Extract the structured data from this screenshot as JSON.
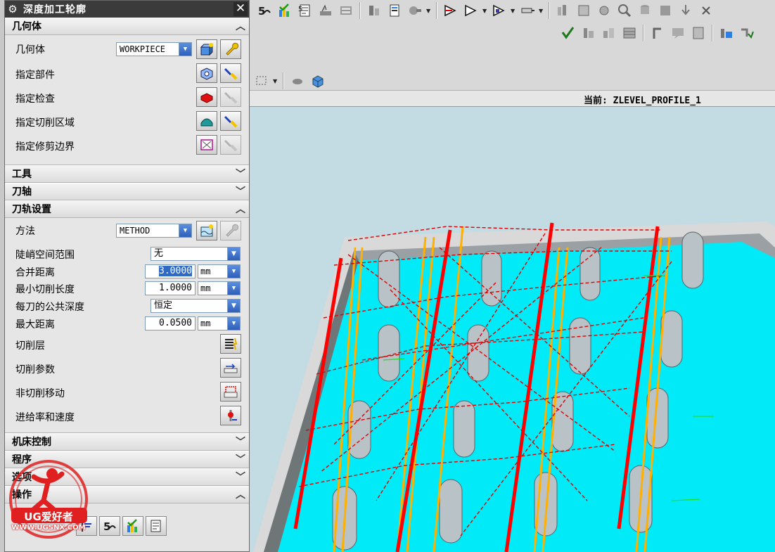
{
  "dialog": {
    "title": "深度加工轮廓",
    "sections": {
      "geometry": "几何体",
      "tool": "工具",
      "tool_axis": "刀轴",
      "path_settings": "刀轨设置",
      "machine_control": "机床控制",
      "program": "程序",
      "options": "选项",
      "actions": "操作"
    },
    "geometry": {
      "geometry_label": "几何体",
      "geometry_value": "WORKPIECE",
      "part_label": "指定部件",
      "check_label": "指定检查",
      "cut_area_label": "指定切削区域",
      "trim_label": "指定修剪边界"
    },
    "path_settings": {
      "method_label": "方法",
      "method_value": "METHOD",
      "steep_label": "陡峭空间范围",
      "steep_value": "无",
      "merge_label": "合并距离",
      "merge_value": "3.0000",
      "merge_unit": "mm",
      "min_len_label": "最小切削长度",
      "min_len_value": "1.0000",
      "min_len_unit": "mm",
      "depth_label": "每刀的公共深度",
      "depth_value": "恒定",
      "max_dist_label": "最大距离",
      "max_dist_value": "0.0500",
      "max_dist_unit": "mm",
      "cut_levels_label": "切削层",
      "cut_params_label": "切削参数",
      "non_cut_label": "非切削移动",
      "feeds_label": "进给率和速度"
    }
  },
  "status": {
    "current_operation": "当前: ZLEVEL_PROFILE_1"
  },
  "watermark": {
    "brand": "UG爱好者",
    "url": "WWW.UGSNX.COM"
  },
  "colors": {
    "titlebar": "#3b3b3b",
    "viewport_bg": "#c3dbe2",
    "surface_cyan": "#00f0ff",
    "toolpath_red": "#ff0000",
    "toolpath_orange": "#ffb000"
  },
  "icons": [
    "gear-icon",
    "close-icon",
    "chevron-up-icon",
    "chevron-down-icon",
    "new-geometry-icon",
    "edit-wrench-icon",
    "select-flashlight-icon"
  ]
}
